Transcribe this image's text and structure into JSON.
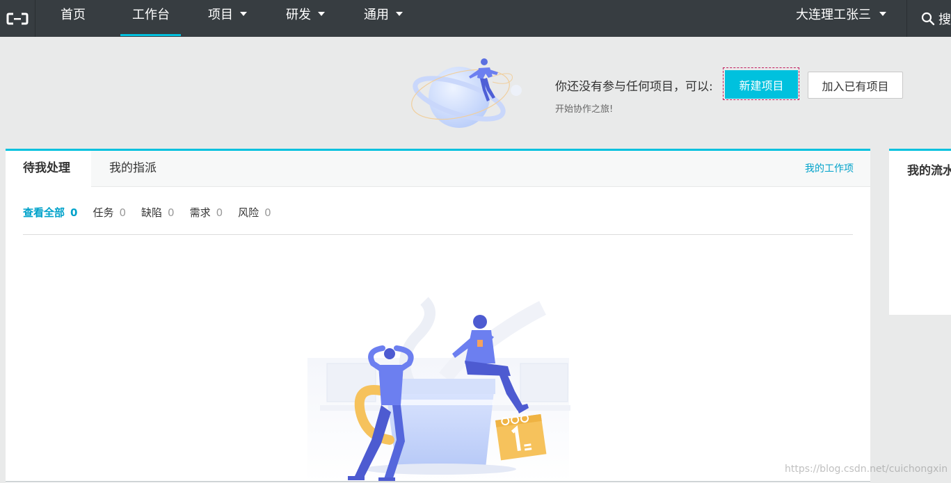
{
  "topbar": {
    "nav": [
      {
        "label": "首页",
        "dropdown": false
      },
      {
        "label": "工作台",
        "dropdown": false,
        "active": true
      },
      {
        "label": "项目",
        "dropdown": true
      },
      {
        "label": "研发",
        "dropdown": true
      },
      {
        "label": "通用",
        "dropdown": true
      }
    ],
    "user_name": "大连理工张三",
    "search_label": "搜索"
  },
  "banner": {
    "message": "你还没有参与任何项目，可以:",
    "sub_message": "开始协作之旅!",
    "new_project_label": "新建项目",
    "join_project_label": "加入已有项目"
  },
  "main_card": {
    "tabs": [
      {
        "label": "待我处理",
        "active": true
      },
      {
        "label": "我的指派",
        "active": false
      }
    ],
    "header_link": "我的工作项",
    "filters": [
      {
        "label": "查看全部",
        "count": "0",
        "active": true
      },
      {
        "label": "任务",
        "count": "0"
      },
      {
        "label": "缺陷",
        "count": "0"
      },
      {
        "label": "需求",
        "count": "0"
      },
      {
        "label": "风险",
        "count": "0"
      }
    ]
  },
  "side_card": {
    "title": "我的流水线"
  },
  "watermark": "https://blog.csdn.net/cuichongxin",
  "colors": {
    "accent": "#00c1de",
    "link": "#00a2ca",
    "topbar": "#373d41",
    "background": "#e9eaea"
  }
}
